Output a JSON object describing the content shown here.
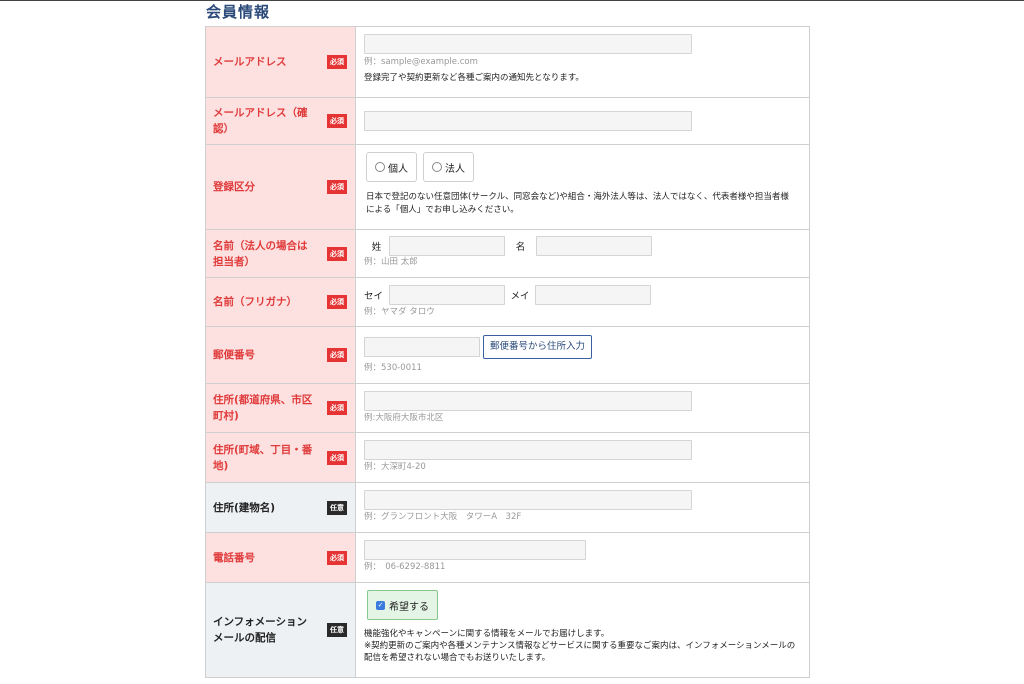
{
  "section_title": "会員情報",
  "badges": {
    "required": "必須",
    "optional": "任意"
  },
  "rows": {
    "email": {
      "label": "メールアドレス",
      "placeholder": "",
      "hint": "例：sample@example.com",
      "note": "登録完了や契約更新など各種ご案内の通知先となります。"
    },
    "email_confirm": {
      "label": "メールアドレス（確認）",
      "placeholder": ""
    },
    "reg_type": {
      "label": "登録区分",
      "options": [
        "個人",
        "法人"
      ],
      "note": "日本で登記のない任意団体(サークル、同窓会など)や組合・海外法人等は、法人ではなく、代表者様や担当者様による「個人」でお申し込みください。"
    },
    "name": {
      "label": "名前（法人の場合は担当者）",
      "last_label": "姓",
      "first_label": "名",
      "hint": "例：山田 太郎"
    },
    "kana": {
      "label": "名前（フリガナ）",
      "last_label": "セイ",
      "first_label": "メイ",
      "hint": "例：ヤマダ タロウ"
    },
    "postal": {
      "label": "郵便番号",
      "button": "郵便番号から住所入力",
      "hint": "例：530-0011"
    },
    "address1": {
      "label": "住所(都道府県、市区町村)",
      "hint": "例:大阪府大阪市北区"
    },
    "address2": {
      "label": "住所(町域、丁目・番地)",
      "hint": "例：大深町4-20"
    },
    "building": {
      "label": "住所(建物名)",
      "hint": "例：グランフロント大阪　タワーA　32F"
    },
    "phone": {
      "label": "電話番号",
      "hint": "例：　06-6292-8811"
    },
    "newsletter": {
      "label": "インフォメーションメールの配信",
      "checkbox_label": "希望する",
      "checked": true,
      "note1": "機能強化やキャンペーンに関する情報をメールでお届けします。",
      "note2": "※契約更新のご案内や各種メンテナンス情報などサービスに関する重要なご案内は、インフォメーションメールの配信を希望されない場合でもお送りいたします。"
    }
  },
  "colors": {
    "required_bg": "#fde1e1",
    "required_text": "#e03b3b",
    "optional_bg": "#eef1f4",
    "badge_required": "#e63333",
    "badge_optional": "#2a2a2a",
    "accent": "#2b4a7a"
  }
}
